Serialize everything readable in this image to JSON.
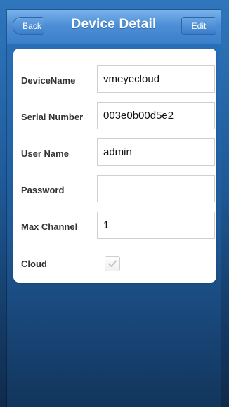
{
  "nav": {
    "title": "Device Detail",
    "back_label": "Back",
    "edit_label": "Edit"
  },
  "form": {
    "fields": [
      {
        "label": "DeviceName",
        "value": "vmeyecloud"
      },
      {
        "label": "Serial Number",
        "value": "003e0b00d5e2"
      },
      {
        "label": "User Name",
        "value": "admin"
      },
      {
        "label": "Password",
        "value": ""
      },
      {
        "label": "Max Channel",
        "value": "1"
      }
    ],
    "cloud": {
      "label": "Cloud",
      "checked": true,
      "icon": "checkmark-icon"
    }
  },
  "colors": {
    "background_top": "#2f76bd",
    "background_bottom": "#0f2a4a",
    "topbar_top": "#7ab3ea",
    "topbar_bottom": "#3b7fcb",
    "card": "#ffffff",
    "label_text": "#333333"
  }
}
